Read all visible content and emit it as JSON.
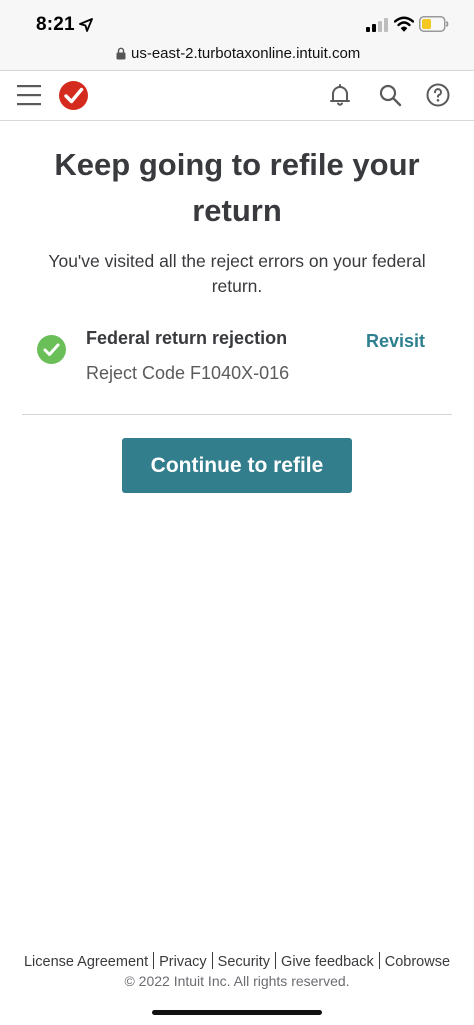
{
  "status_bar": {
    "time": "8:21",
    "location_icon": "location-arrow-icon",
    "signal_icon": "cellular-signal-icon",
    "wifi_icon": "wifi-icon",
    "battery_icon": "battery-low-icon",
    "battery_color": "#f5c81f"
  },
  "browser": {
    "url": "us-east-2.turbotaxonline.intuit.com",
    "lock_icon": "lock-icon"
  },
  "header": {
    "menu_icon": "hamburger-menu-icon",
    "logo_icon": "turbotax-checkmark-logo-icon",
    "logo_color": "#d52b1e",
    "notifications_icon": "bell-icon",
    "search_icon": "search-icon",
    "help_icon": "question-circle-icon"
  },
  "main": {
    "title": "Keep going to refile your return",
    "subtitle": "You've visited all the reject errors on your federal return.",
    "rejection": {
      "status_icon": "green-check-circle-icon",
      "status_color": "#6bbf59",
      "title": "Federal return rejection",
      "code": "Reject Code F1040X-016",
      "action_label": "Revisit"
    },
    "continue_label": "Continue to refile",
    "accent_color": "#327e8c"
  },
  "footer": {
    "links": [
      "License Agreement",
      "Privacy",
      "Security",
      "Give feedback",
      "Cobrowse"
    ],
    "copyright": "© 2022 Intuit Inc. All rights reserved."
  }
}
